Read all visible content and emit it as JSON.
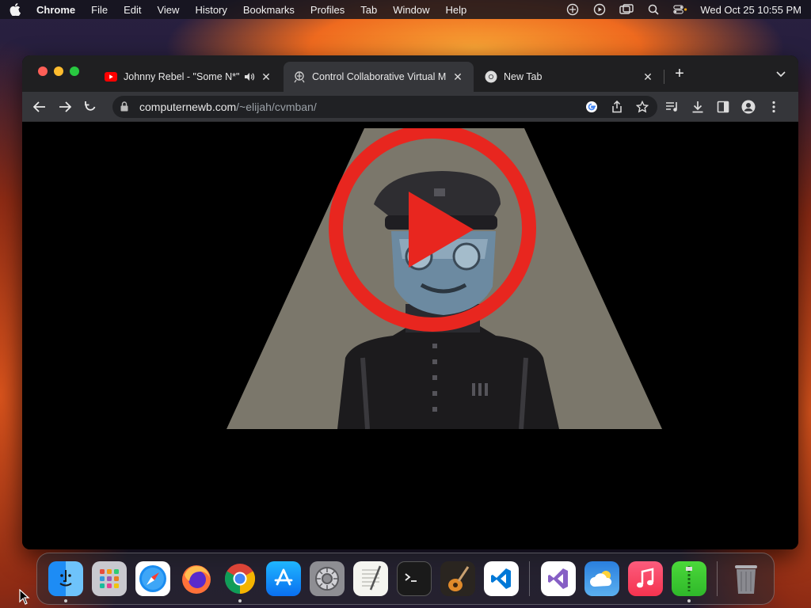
{
  "menubar": {
    "app_name": "Chrome",
    "menus": [
      "File",
      "Edit",
      "View",
      "History",
      "Bookmarks",
      "Profiles",
      "Tab",
      "Window",
      "Help"
    ],
    "clock": "Wed Oct 25  10:55 PM"
  },
  "tabs": [
    {
      "title": "Johnny Rebel - \"Some N*\"",
      "favicon": "youtube-icon",
      "audio": true,
      "active": false
    },
    {
      "title": "Control Collaborative Virtual M",
      "favicon": "site-icon",
      "audio": false,
      "active": true
    },
    {
      "title": "New Tab",
      "favicon": "chrome-icon",
      "audio": false,
      "active": false
    }
  ],
  "omnibox": {
    "host": "computernewb.com",
    "path": "/~elijah/cvmban/"
  },
  "dock": {
    "apps": [
      {
        "name": "Finder",
        "icon": "finder-icon",
        "running": true
      },
      {
        "name": "Launchpad",
        "icon": "launchpad-icon",
        "running": false
      },
      {
        "name": "Safari",
        "icon": "safari-icon",
        "running": false
      },
      {
        "name": "Firefox",
        "icon": "firefox-icon",
        "running": false
      },
      {
        "name": "Chrome",
        "icon": "chrome-icon",
        "running": true
      },
      {
        "name": "App Store",
        "icon": "app-store-icon",
        "running": false
      },
      {
        "name": "System Settings",
        "icon": "settings-icon",
        "running": false
      },
      {
        "name": "TextEdit",
        "icon": "textedit-icon",
        "running": false
      },
      {
        "name": "Terminal",
        "icon": "terminal-icon",
        "running": false
      },
      {
        "name": "GarageBand",
        "icon": "garageband-icon",
        "running": false
      },
      {
        "name": "VS Code",
        "icon": "vscode-icon",
        "running": false
      },
      {
        "name": "Visual Studio",
        "icon": "visual-studio-icon",
        "running": false
      },
      {
        "name": "Weather",
        "icon": "weather-icon",
        "running": false
      },
      {
        "name": "Music",
        "icon": "music-icon",
        "running": false
      },
      {
        "name": "Archive Utility",
        "icon": "archive-icon",
        "running": true
      },
      {
        "name": "Trash",
        "icon": "trash-icon",
        "running": false
      }
    ]
  },
  "colors": {
    "play_red": "#e8261f",
    "spotlight": "#7b776b"
  }
}
